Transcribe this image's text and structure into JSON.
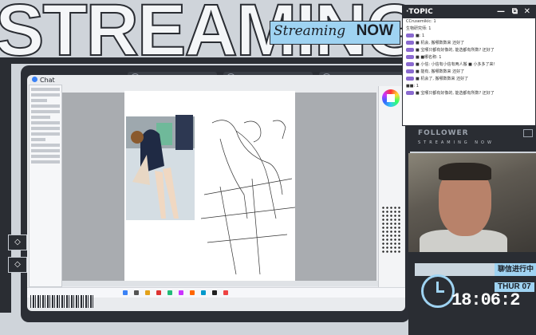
{
  "overlay": {
    "big_title": "STREAMING",
    "badge_script": "Streaming",
    "badge_now": "NOW"
  },
  "app_window": {
    "chat_tab_label": "Chat",
    "frame_tabs": [
      {
        "icon": "globe-icon"
      },
      {
        "icon": "globe-icon"
      },
      {
        "icon": "globe-icon"
      }
    ]
  },
  "topic_panel": {
    "title": "·TOPIC",
    "controls": [
      "—",
      "⧉",
      "✕"
    ],
    "messages": [
      "CCrusemikic: 1",
      "生物研究师: 1",
      "■: 1",
      "■ 机会, 搬哪数数来 还好了",
      "■ 宝哪只都有好像的, 能选都有所数? 还好了",
      "■ ■哪名称: 1",
      "■ 小信: 小信有小信有两人搬 ■ 小多多了来!",
      "■ 能有, 搬哪数数来 还好了",
      "■ 机会了, 搬哪数数来 还好了",
      "■■: 1",
      "■ 宝哪只都有好像的, 能选都有所数? 还好了"
    ]
  },
  "follower": {
    "title": "FOLLOWER",
    "subtitle": "STREAMING NOW"
  },
  "clock": {
    "status_button": "聊信进行中",
    "date": "THUR 07",
    "time": "18:06:2"
  },
  "side_buttons": [
    "◇",
    "◇"
  ],
  "colors": {
    "accent": "#9fd3f2",
    "dark": "#2a2d33",
    "background": "#cfd4da"
  }
}
